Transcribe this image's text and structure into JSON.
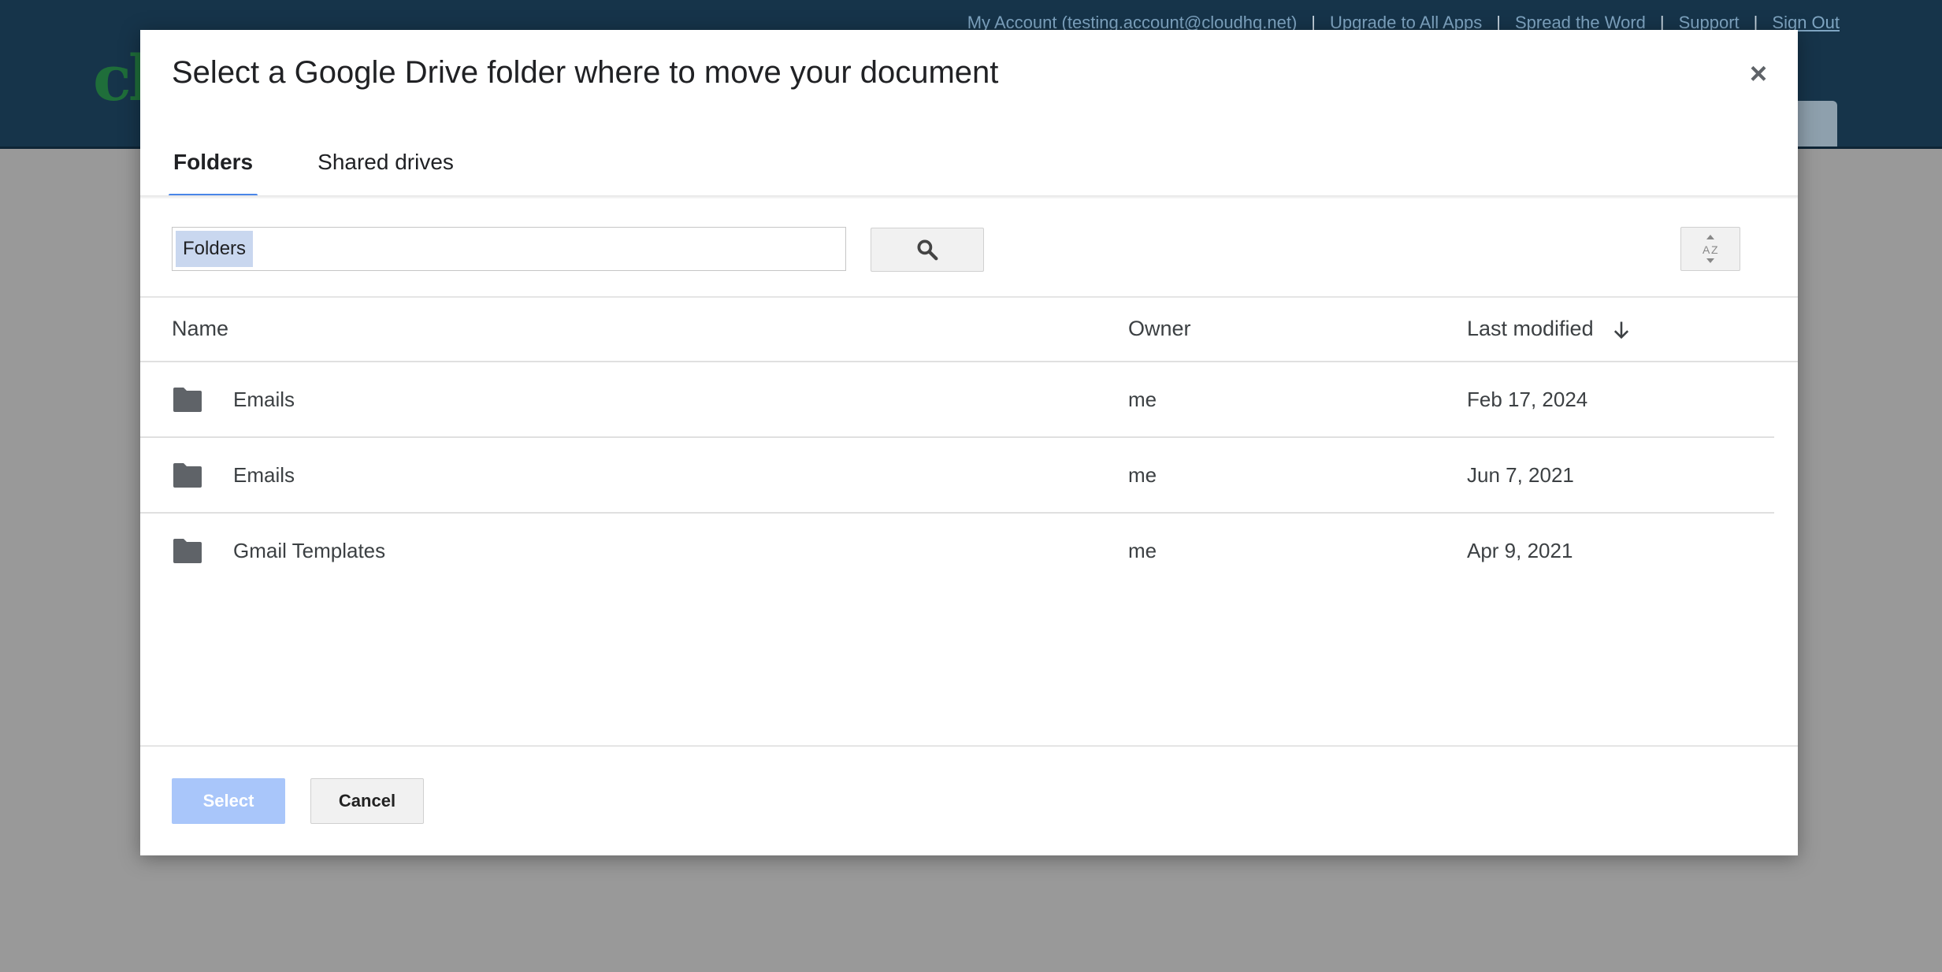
{
  "app": {
    "logo_text": "cl",
    "top_links": [
      "My Account (testing.account@cloudhq.net)",
      "Upgrade to All Apps",
      "Spread the Word",
      "Support",
      "Sign Out"
    ],
    "separator": "|"
  },
  "dialog": {
    "title": "Select a Google Drive folder where to move your document",
    "close_label": "×",
    "tabs": [
      {
        "label": "Folders",
        "active": true
      },
      {
        "label": "Shared drives",
        "active": false
      }
    ],
    "search": {
      "value": "Folders",
      "icon": "search-icon"
    },
    "sort_icon": "sort-az-icon",
    "columns": {
      "name": "Name",
      "owner": "Owner",
      "modified": "Last modified",
      "sort_icon": "arrow-down-icon"
    },
    "rows": [
      {
        "name": "Emails",
        "owner": "me",
        "modified": "Feb 17, 2024",
        "icon": "folder-icon"
      },
      {
        "name": "Emails",
        "owner": "me",
        "modified": "Jun 7, 2021",
        "icon": "folder-icon"
      },
      {
        "name": "Gmail Templates",
        "owner": "me",
        "modified": "Apr 9, 2021",
        "icon": "folder-icon"
      }
    ],
    "buttons": {
      "select": "Select",
      "cancel": "Cancel"
    }
  },
  "colors": {
    "header_bg": "#16344a",
    "overlay_bg": "#999999",
    "tab_indicator": "#4a86e8",
    "select_button": "#a9c6fa",
    "folder_icon": "#5f6368"
  }
}
